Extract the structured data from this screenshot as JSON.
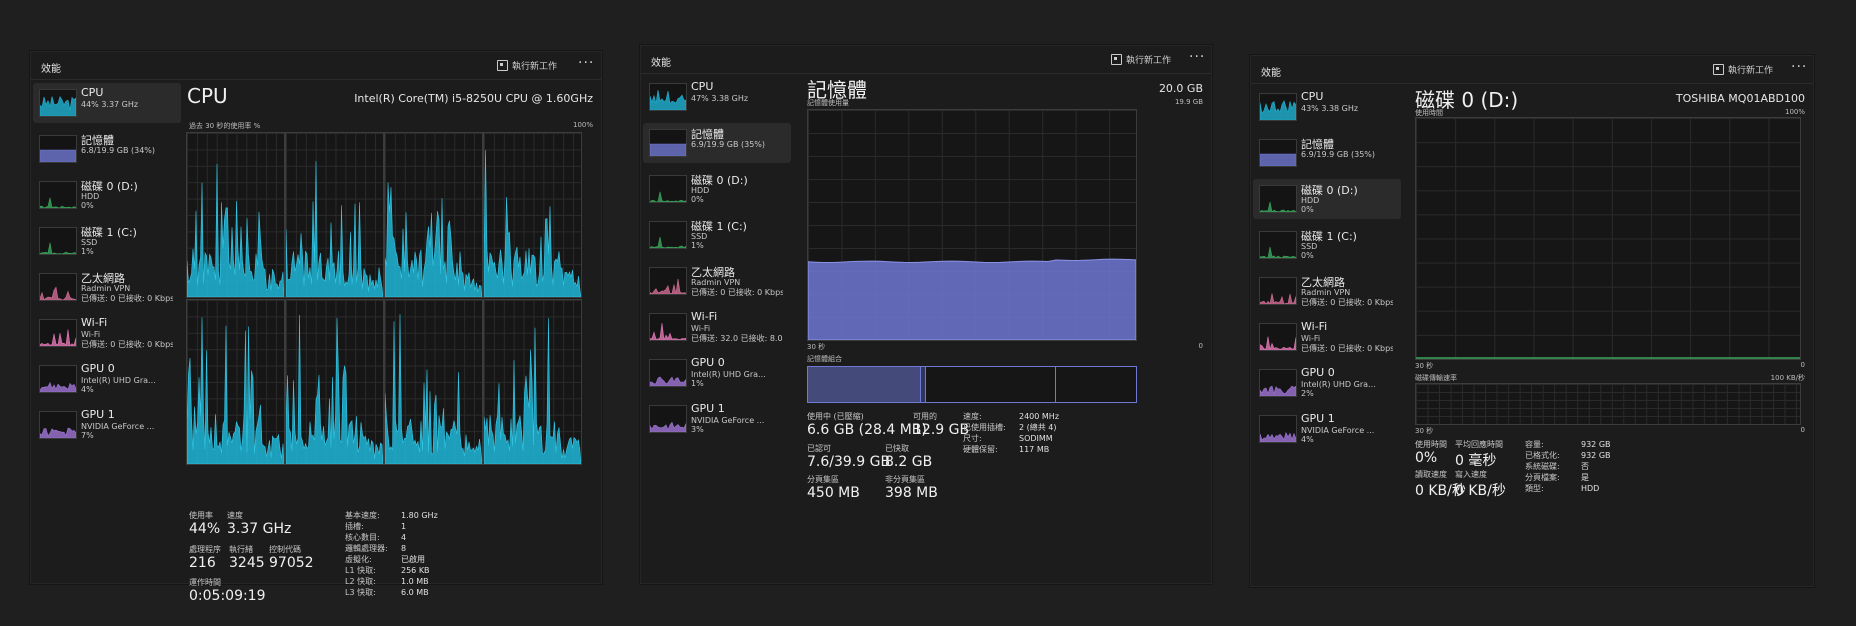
{
  "colors": {
    "cpu": "#1fb3d3",
    "memory": "#6f78d2",
    "disk": "#3aa55c",
    "ethernet": "#d06c93",
    "wifi": "#e277b5",
    "gpu": "#a076d6"
  },
  "common": {
    "header_title": "效能",
    "run_task": "執行新工作",
    "more": "···",
    "icons": {
      "run": "run-task-icon",
      "more": "more-options-icon"
    }
  },
  "windows": [
    {
      "sidebar": [
        {
          "name": "CPU",
          "l2": "44% 3.37 GHz",
          "l3": ""
        },
        {
          "name": "記憶體",
          "l2": "6.8/19.9 GB (34%)",
          "l3": ""
        },
        {
          "name": "磁碟 0 (D:)",
          "l2": "HDD",
          "l3": "0%"
        },
        {
          "name": "磁碟 1 (C:)",
          "l2": "SSD",
          "l3": "1%"
        },
        {
          "name": "乙太網路",
          "l2": "Radmin VPN",
          "l3": "已傳送: 0 已接收: 0 Kbps"
        },
        {
          "name": "Wi-Fi",
          "l2": "Wi-Fi",
          "l3": "已傳送: 0 已接收: 0 Kbps"
        },
        {
          "name": "GPU 0",
          "l2": "Intel(R) UHD Gra...",
          "l3": "4%"
        },
        {
          "name": "GPU 1",
          "l2": "NVIDIA GeForce ...",
          "l3": "7%"
        }
      ]
    },
    {
      "sidebar": [
        {
          "name": "CPU",
          "l2": "47% 3.38 GHz",
          "l3": ""
        },
        {
          "name": "記憶體",
          "l2": "6.9/19.9 GB (35%)",
          "l3": ""
        },
        {
          "name": "磁碟 0 (D:)",
          "l2": "HDD",
          "l3": "0%"
        },
        {
          "name": "磁碟 1 (C:)",
          "l2": "SSD",
          "l3": "1%"
        },
        {
          "name": "乙太網路",
          "l2": "Radmin VPN",
          "l3": "已傳送: 0 已接收: 0 Kbps"
        },
        {
          "name": "Wi-Fi",
          "l2": "Wi-Fi",
          "l3": "已傳送: 32.0 已接收: 8.0"
        },
        {
          "name": "GPU 0",
          "l2": "Intel(R) UHD Gra...",
          "l3": "1%"
        },
        {
          "name": "GPU 1",
          "l2": "NVIDIA GeForce ...",
          "l3": "3%"
        }
      ]
    },
    {
      "sidebar": [
        {
          "name": "CPU",
          "l2": "43% 3.38 GHz",
          "l3": ""
        },
        {
          "name": "記憶體",
          "l2": "6.9/19.9 GB (35%)",
          "l3": ""
        },
        {
          "name": "磁碟 0 (D:)",
          "l2": "HDD",
          "l3": "0%"
        },
        {
          "name": "磁碟 1 (C:)",
          "l2": "SSD",
          "l3": "0%"
        },
        {
          "name": "乙太網路",
          "l2": "Radmin VPN",
          "l3": "已傳送: 0 已接收: 0 Kbps"
        },
        {
          "name": "Wi-Fi",
          "l2": "Wi-Fi",
          "l3": "已傳送: 0 已接收: 0 Kbps"
        },
        {
          "name": "GPU 0",
          "l2": "Intel(R) UHD Gra...",
          "l3": "2%"
        },
        {
          "name": "GPU 1",
          "l2": "NVIDIA GeForce ...",
          "l3": "4%"
        }
      ]
    }
  ],
  "cpu": {
    "title": "CPU",
    "model": "Intel(R) Core(TM) i5-8250U CPU @ 1.60GHz",
    "graph_label": "過去 30 秒的使用率 %",
    "graph_max": "100%",
    "stats": [
      {
        "k": "使用率",
        "v": "44%"
      },
      {
        "k": "速度",
        "v": "3.37 GHz"
      },
      {
        "k": "處理程序",
        "v": "216"
      },
      {
        "k": "執行緒",
        "v": "3245"
      },
      {
        "k": "控制代碼",
        "v": "97052"
      },
      {
        "k": "運作時間",
        "v": "0:05:09:19"
      }
    ],
    "details": [
      [
        "基本速度:",
        "1.80 GHz"
      ],
      [
        "插槽:",
        "1"
      ],
      [
        "核心數目:",
        "4"
      ],
      [
        "邏輯處理器:",
        "8"
      ],
      [
        "虛擬化:",
        "已啟用"
      ],
      [
        "L1 快取:",
        "256 KB"
      ],
      [
        "L2 快取:",
        "1.0 MB"
      ],
      [
        "L3 快取:",
        "6.0 MB"
      ]
    ]
  },
  "memory": {
    "title": "記憶體",
    "total": "20.0 GB",
    "usage_label": "記憶體使用量",
    "usage_max": "19.9 GB",
    "x_left": "30 秒",
    "x_right": "0",
    "comp_label": "記憶體組合",
    "usage_level": 0.34,
    "stats": [
      {
        "k": "使用中 (已壓縮)",
        "v": "6.6 GB (28.4 MB)"
      },
      {
        "k": "可用的",
        "v": "12.9 GB"
      },
      {
        "k": "已認可",
        "v": "7.6/39.9 GB"
      },
      {
        "k": "已快取",
        "v": "8.2 GB"
      },
      {
        "k": "分頁集區",
        "v": "450 MB"
      },
      {
        "k": "非分頁集區",
        "v": "398 MB"
      }
    ],
    "details": [
      [
        "速度:",
        "2400 MHz"
      ],
      [
        "已使用插槽:",
        "2 (總共 4)"
      ],
      [
        "尺寸:",
        "SODIMM"
      ],
      [
        "硬體保留:",
        "117 MB"
      ]
    ]
  },
  "disk": {
    "title": "磁碟 0 (D:)",
    "model": "TOSHIBA MQ01ABD100",
    "active_label": "使用時間",
    "active_max": "100%",
    "x_left": "30 秒",
    "x_right": "0",
    "rate_label": "磁碟傳輸速率",
    "rate_max": "100 KB/秒",
    "x2_left": "30 秒",
    "x2_right": "0",
    "stats": [
      {
        "k": "使用時間",
        "v": "0%"
      },
      {
        "k": "平均回應時間",
        "v": "0 毫秒"
      },
      {
        "k": "讀取速度",
        "v": "0 KB/秒"
      },
      {
        "k": "寫入速度",
        "v": "0 KB/秒"
      }
    ],
    "details": [
      [
        "容量:",
        "932 GB"
      ],
      [
        "已格式化:",
        "932 GB"
      ],
      [
        "系統磁碟:",
        "否"
      ],
      [
        "分頁檔案:",
        "是"
      ],
      [
        "類型:",
        "HDD"
      ]
    ]
  }
}
